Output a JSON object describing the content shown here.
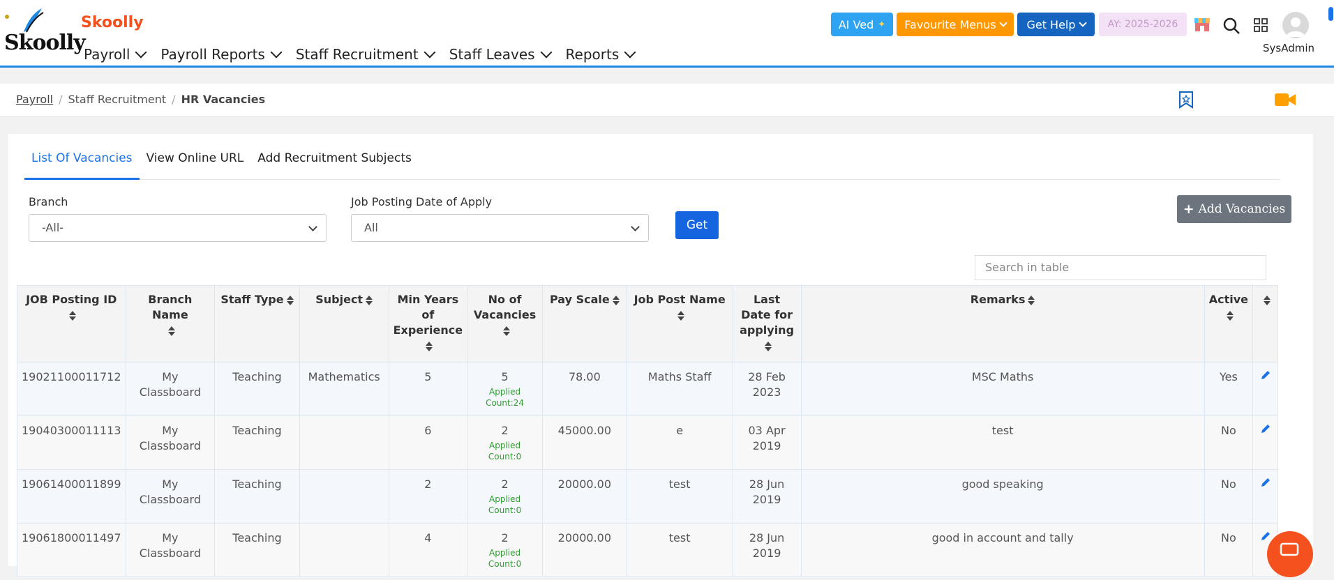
{
  "header": {
    "brand": "Skoolly",
    "logo_text": "Skoolly",
    "nav": [
      "Payroll",
      "Payroll Reports",
      "Staff Recruitment",
      "Staff Leaves",
      "Reports"
    ],
    "ai_label": "AI Ved",
    "fav_label": "Favourite Menus",
    "help_label": "Get Help",
    "ay_label": "AY: 2025-2026",
    "user": "SysAdmin",
    "icons": [
      "store-icon",
      "search-icon",
      "apps-icon",
      "avatar-icon"
    ]
  },
  "breadcrumb": {
    "items": [
      "Payroll",
      "Staff Recruitment",
      "HR Vacancies"
    ],
    "sep": "/"
  },
  "tabs": [
    "List Of Vacancies",
    "View Online URL",
    "Add Recruitment Subjects"
  ],
  "filters": {
    "branch_label": "Branch",
    "branch_value": "-All-",
    "date_label": "Job Posting Date of Apply",
    "date_value": "All",
    "get_label": "Get",
    "add_label": "Add Vacancies"
  },
  "search": {
    "placeholder": "Search in table"
  },
  "table": {
    "headers": [
      "JOB Posting ID",
      "Branch Name",
      "Staff Type",
      "Subject",
      "Min Years of Experience",
      "No of Vacancies",
      "Pay Scale",
      "Job Post Name",
      "Last Date for applying",
      "Remarks",
      "Active",
      ""
    ],
    "rows": [
      {
        "id": "19021100011712",
        "branch": "My Classboard",
        "type": "Teaching",
        "subject": "Mathematics",
        "exp": "5",
        "vac": "5",
        "applied": "Applied Count:24",
        "pay": "78.00",
        "post": "Maths Staff",
        "date": "28 Feb 2023",
        "remarks": "MSC Maths",
        "active": "Yes"
      },
      {
        "id": "19040300011113",
        "branch": "My Classboard",
        "type": "Teaching",
        "subject": "",
        "exp": "6",
        "vac": "2",
        "applied": "Applied Count:0",
        "pay": "45000.00",
        "post": "e",
        "date": "03 Apr 2019",
        "remarks": "test",
        "active": "No"
      },
      {
        "id": "19061400011899",
        "branch": "My Classboard",
        "type": "Teaching",
        "subject": "",
        "exp": "2",
        "vac": "2",
        "applied": "Applied Count:0",
        "pay": "20000.00",
        "post": "test",
        "date": "28 Jun 2019",
        "remarks": "good speaking",
        "active": "No"
      },
      {
        "id": "19061800011497",
        "branch": "My Classboard",
        "type": "Teaching",
        "subject": "",
        "exp": "4",
        "vac": "2",
        "applied": "Applied Count:0",
        "pay": "20000.00",
        "post": "test",
        "date": "28 Jun 2019",
        "remarks": "good in account and tally",
        "active": "No"
      }
    ]
  },
  "colors": {
    "accent": "#1a73e8",
    "brand": "#f4511e",
    "applied": "#2e9b2e"
  }
}
